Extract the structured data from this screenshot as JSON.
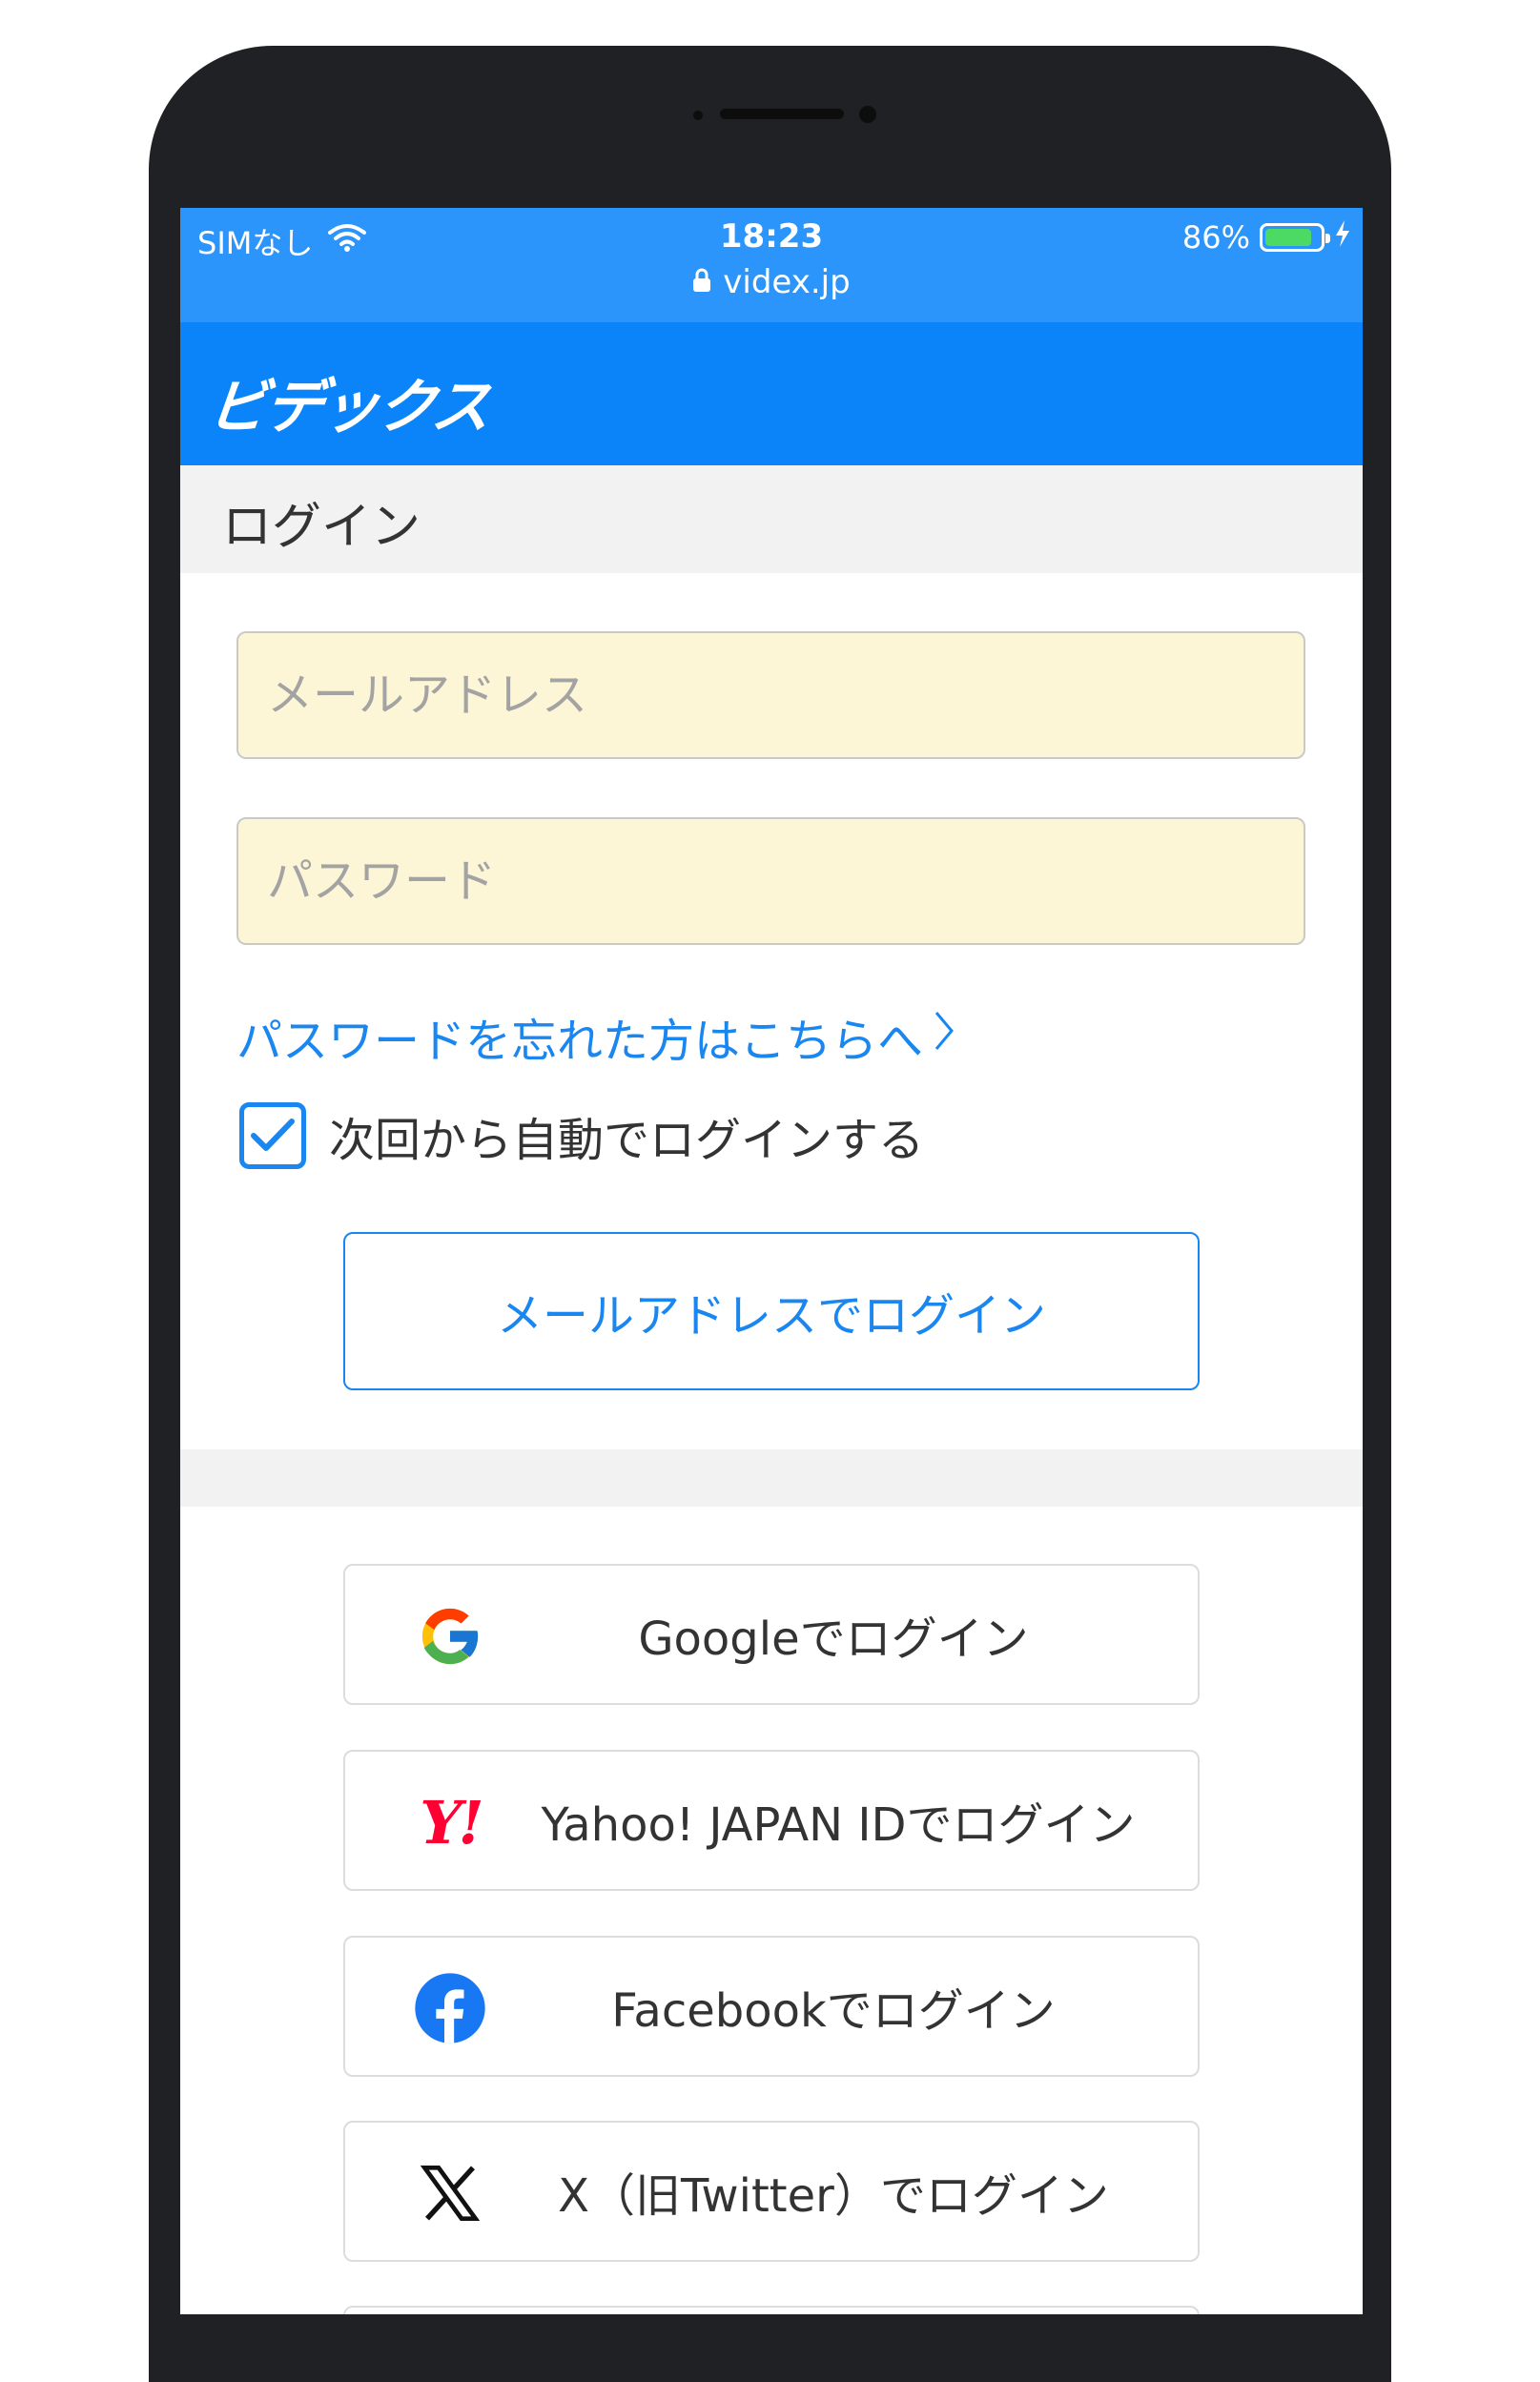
{
  "status_bar": {
    "carrier": "SIMなし",
    "time": "18:23",
    "url": "videx.jp",
    "battery": "86%",
    "battery_level": 0.86
  },
  "app": {
    "logo": "ビデックス"
  },
  "login": {
    "title": "ログイン",
    "email_placeholder": "メールアドレス",
    "password_placeholder": "パスワード",
    "forgot_link": "パスワードを忘れた方はこちらへ",
    "remember_label": "次回から自動でログインする",
    "remember_checked": true,
    "email_login_button": "メールアドレスでログイン"
  },
  "social": [
    {
      "icon": "google-icon",
      "label": "Googleでログイン"
    },
    {
      "icon": "yahoo-japan-icon",
      "label": "Yahoo! JAPAN IDでログイン",
      "icon_text": "Y!"
    },
    {
      "icon": "facebook-icon",
      "label": "Facebookでログイン"
    },
    {
      "icon": "x-icon",
      "label": "X（旧Twitter）でログイン"
    }
  ],
  "colors": {
    "status_bar": "#2b95fb",
    "app_bar": "#0a84f8",
    "accent": "#1a86f0",
    "input_bg": "#fdf6d6",
    "yahoo_red": "#ff0033",
    "facebook_blue": "#1877f2"
  }
}
